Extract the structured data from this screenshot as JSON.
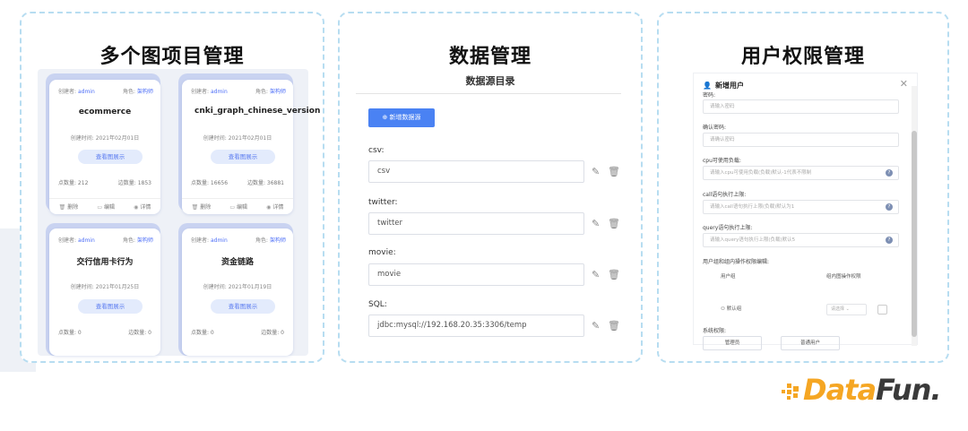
{
  "panels": {
    "projects": {
      "title": "多个图项目管理",
      "cards": [
        {
          "creator_label": "创建者:",
          "creator": "admin",
          "role_label": "角色:",
          "role": "架构师",
          "name": "ecommerce",
          "time": "创建时间: 2021年02月01日",
          "view_label": "查看图展示",
          "points": "点数量: 212",
          "edges": "边数量: 1853",
          "actions": [
            "删除",
            "编辑",
            "详情"
          ]
        },
        {
          "creator_label": "创建者:",
          "creator": "admin",
          "role_label": "角色:",
          "role": "架构师",
          "name": "cnki_graph_chinese_version",
          "time": "创建时间: 2021年02月01日",
          "view_label": "查看图展示",
          "points": "点数量: 16656",
          "edges": "边数量: 36881",
          "actions": [
            "删除",
            "编辑",
            "详情"
          ]
        },
        {
          "creator_label": "创建者:",
          "creator": "admin",
          "role_label": "角色:",
          "role": "架构师",
          "name": "交行信用卡行为",
          "time": "创建时间: 2021年01月25日",
          "view_label": "查看图展示",
          "points": "点数量: 0",
          "edges": "边数量: 0",
          "actions": []
        },
        {
          "creator_label": "创建者:",
          "creator": "admin",
          "role_label": "角色:",
          "role": "架构师",
          "name": "资金链路",
          "time": "创建时间: 2021年01月19日",
          "view_label": "查看图展示",
          "points": "点数量: 0",
          "edges": "边数量: 0",
          "actions": []
        }
      ]
    },
    "data": {
      "title": "数据管理",
      "subtitle": "数据源目录",
      "add_button": "新增数据源",
      "sources": [
        {
          "label": "csv:",
          "value": "csv"
        },
        {
          "label": "twitter:",
          "value": "twitter"
        },
        {
          "label": "movie:",
          "value": "movie"
        },
        {
          "label": "SQL:",
          "value": "jdbc:mysql://192.168.20.35:3306/temp"
        }
      ]
    },
    "users": {
      "title": "用户权限管理",
      "dialog_title": "新增用户",
      "fields": [
        {
          "label": "密码:",
          "placeholder": "请输入密码",
          "help": false
        },
        {
          "label": "确认密码:",
          "placeholder": "请确认密码",
          "help": false
        },
        {
          "label": "cpu可使用负载:",
          "placeholder": "请输入cpu可使用负载(负载)默认-1代表不限制",
          "help": true
        },
        {
          "label": "call语句执行上限:",
          "placeholder": "请输入call语句执行上限(负载)默认为1",
          "help": true
        },
        {
          "label": "query语句执行上限:",
          "placeholder": "请输入query语句执行上限(负载)默认5",
          "help": true
        }
      ],
      "perm_section_label": "用户组和组内操作权限编辑:",
      "perm_col_group": "用户组",
      "perm_col_ops": "组内图操作权限",
      "perm_group_name": "默认组",
      "perm_select_placeholder": "请选择",
      "system_perm_label": "系统权限:",
      "system_buttons": [
        "管理员",
        "普通用户"
      ]
    }
  },
  "logo": {
    "prefix": "Data",
    "suffix": "Fun."
  },
  "colors": {
    "accent": "#4a82f3",
    "panel_border": "#b7ddf1",
    "logo_orange": "#f5a623"
  }
}
